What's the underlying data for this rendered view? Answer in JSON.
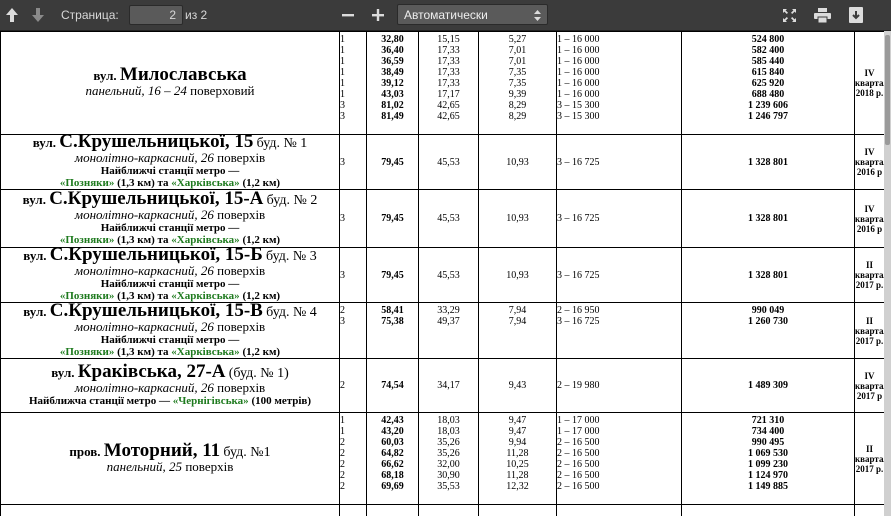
{
  "toolbar": {
    "page_label": "Страница:",
    "page_value": "2",
    "page_total": "из 2",
    "zoom_value": "Автоматически"
  },
  "colors": {
    "toolbar_bg": "#3b3b3b",
    "metro_green": "#1e7a1e"
  },
  "icons": [
    "arrow-up-icon",
    "arrow-down-icon",
    "minus-icon",
    "plus-icon",
    "chevron-updown-icon",
    "fullscreen-icon",
    "print-icon",
    "download-icon"
  ],
  "buildings": [
    {
      "street": "вул.",
      "name": "Милославська",
      "building": "",
      "type": "панельний, 16 – 24",
      "floors": "поверховий",
      "metro": "",
      "rows": [
        [
          "1",
          "32,80",
          "15,15",
          "5,27",
          "1 – 16 000",
          "524 800"
        ],
        [
          "1",
          "36,40",
          "17,33",
          "7,01",
          "1 – 16 000",
          "582 400"
        ],
        [
          "1",
          "36,59",
          "17,33",
          "7,01",
          "1 – 16 000",
          "585 440"
        ],
        [
          "1",
          "38,49",
          "17,33",
          "7,35",
          "1 – 16 000",
          "615 840"
        ],
        [
          "1",
          "39,12",
          "17,33",
          "7,35",
          "1 – 16 000",
          "625 920"
        ],
        [
          "1",
          "43,03",
          "17,17",
          "9,39",
          "1 – 16 000",
          "688 480"
        ],
        [
          "3",
          "81,02",
          "42,65",
          "8,29",
          "3 – 15 300",
          "1 239 606"
        ],
        [
          "3",
          "81,49",
          "42,65",
          "8,29",
          "3 – 15 300",
          "1 246 797"
        ]
      ],
      "quarter": [
        "IV",
        "квартал",
        "2018 р."
      ]
    },
    {
      "street": "вул.",
      "name": "С.Крушельницької, 15",
      "building": "буд. № 1",
      "type": "монолітно-каркасний, 26",
      "floors": "поверхів",
      "metro": {
        "label": "Найближчі станції метро —",
        "s1": "«Позняки»",
        "d1": "(1,3 км) та",
        "s2": "«Харківська»",
        "d2": "(1,2 км)"
      },
      "rows": [
        [
          "3",
          "79,45",
          "45,53",
          "10,93",
          "3 – 16 725",
          "1 328 801"
        ]
      ],
      "quarter": [
        "IV",
        "квартал",
        "2016 р"
      ]
    },
    {
      "street": "вул.",
      "name": "С.Крушельницької, 15-А",
      "building": "буд. № 2",
      "type": "монолітно-каркасний, 26",
      "floors": "поверхів",
      "metro": {
        "label": "Найближчі станції метро —",
        "s1": "«Позняки»",
        "d1": "(1,3 км) та",
        "s2": "«Харківська»",
        "d2": "(1,2 км)"
      },
      "rows": [
        [
          "3",
          "79,45",
          "45,53",
          "10,93",
          "3 – 16 725",
          "1 328 801"
        ]
      ],
      "quarter": [
        "IV",
        "квартал",
        "2016 р"
      ]
    },
    {
      "street": "вул.",
      "name": "С.Крушельницької, 15-Б",
      "building": "буд. № 3",
      "type": "монолітно-каркасний, 26",
      "floors": "поверхів",
      "metro": {
        "label": "Найближчі станції метро —",
        "s1": "«Позняки»",
        "d1": "(1,3 км) та",
        "s2": "«Харківська»",
        "d2": "(1,2 км)"
      },
      "rows": [
        [
          "3",
          "79,45",
          "45,53",
          "10,93",
          "3 – 16 725",
          "1 328 801"
        ]
      ],
      "quarter": [
        "II",
        "квартал",
        "2017 р."
      ]
    },
    {
      "street": "вул.",
      "name": "С.Крушельницької, 15-В",
      "building": "буд. № 4",
      "type": "монолітно-каркасний, 26",
      "floors": "поверхів",
      "metro": {
        "label": "Найближчі станції метро —",
        "s1": "«Позняки»",
        "d1": "(1,3 км) та",
        "s2": "«Харківська»",
        "d2": "(1,2 км)"
      },
      "rows": [
        [
          "2",
          "58,41",
          "33,29",
          "7,94",
          "2 – 16 950",
          "990 049"
        ],
        [
          "3",
          "75,38",
          "49,37",
          "7,94",
          "3 – 16 725",
          "1 260 730"
        ]
      ],
      "quarter": [
        "II",
        "квартал",
        "2017 р."
      ]
    },
    {
      "street": "вул.",
      "name": "Краківська, 27-А",
      "building": "(буд. № 1)",
      "type": "монолітно-каркасний, 26",
      "floors": "поверхів",
      "metro": {
        "label": "Найближча станції метро —",
        "s1": "«Чернігівська»",
        "d1": "(100 метрів)",
        "s2": "",
        "d2": ""
      },
      "rows": [
        [
          "2",
          "74,54",
          "34,17",
          "9,43",
          "2 – 19 980",
          "1 489 309"
        ]
      ],
      "quarter": [
        "IV",
        "квартал",
        "2017 р"
      ]
    },
    {
      "street": "пров.",
      "name": "Моторний, 11",
      "building": "буд. №1",
      "type": "панельний, 25",
      "floors": "поверхів",
      "metro": "",
      "rows": [
        [
          "1",
          "42,43",
          "18,03",
          "9,47",
          "1 – 17 000",
          "721 310"
        ],
        [
          "1",
          "43,20",
          "18,03",
          "9,47",
          "1 – 17 000",
          "734 400"
        ],
        [
          "2",
          "60,03",
          "35,26",
          "9,94",
          "2 – 16 500",
          "990 495"
        ],
        [
          "2",
          "64,82",
          "35,26",
          "11,28",
          "2 – 16 500",
          "1 069 530"
        ],
        [
          "2",
          "66,62",
          "32,00",
          "10,25",
          "2 – 16 500",
          "1 099 230"
        ],
        [
          "2",
          "68,18",
          "30,90",
          "11,28",
          "2 – 16 500",
          "1 124 970"
        ],
        [
          "2",
          "69,69",
          "35,53",
          "12,32",
          "2 – 16 500",
          "1 149 885"
        ]
      ],
      "quarter": [
        "II",
        "квартал",
        "2017 р."
      ]
    }
  ]
}
